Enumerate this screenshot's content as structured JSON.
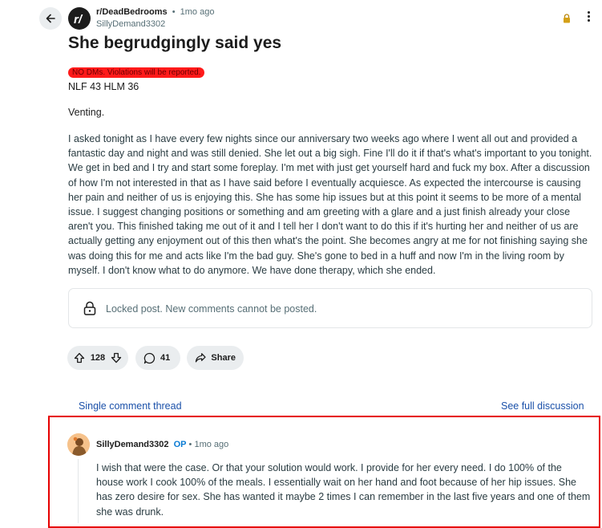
{
  "post": {
    "subreddit": "r/DeadBedrooms",
    "separator": "•",
    "time": "1mo ago",
    "author": "SillyDemand3302",
    "title": "She begrudgingly said yes",
    "flair": "NO DMs. Violations will be reported.",
    "tagline": "NLF 43 HLM 36",
    "venting": "Venting.",
    "body": "I asked tonight as I have every few nights since our anniversary two weeks ago where I went all out and provided a fantastic day and night and was still denied. She let out a big sigh. Fine I'll do it if that's what's important to you tonight. We get in bed and I try and start some foreplay. I'm met with just get yourself hard and fuck my box. After a discussion of how I'm not interested in that as I have said before I eventually acquiesce. As expected the intercourse is causing her pain and neither of us is enjoying this. She has some hip issues but at this point it seems to be more of a mental issue. I suggest changing positions or something and am greeting with a glare and a just finish already your close aren't you. This finished taking me out of it and I tell her I don't want to do this if it's hurting her and neither of us are actually getting any enjoyment out of this then what's the point. She becomes angry at me for not finishing saying she was doing this for me and acts like I'm the bad guy. She's gone to bed in a huff and now I'm in the living room by myself. I don't know what to do anymore. We have done therapy, which she ended.",
    "locked_notice": "Locked post. New comments cannot be posted.",
    "votes": "128",
    "comments": "41",
    "share_label": "Share"
  },
  "thread_nav": {
    "single_thread": "Single comment thread",
    "full_discussion": "See full discussion"
  },
  "comment": {
    "author": "SillyDemand3302",
    "op_badge": "OP",
    "separator": "•",
    "time": "1mo ago",
    "body": "I wish that were the case. Or that your solution would work. I provide for her every need. I do 100% of the house work I cook 100% of the meals. I essentially wait on her hand and foot because of her hip issues. She has zero desire for sex. She has wanted it maybe 2 times I can remember in the last five years and one of them she was drunk."
  },
  "icons": {
    "back": "arrow-left-icon",
    "subreddit_avatar": "subreddit-avatar",
    "lock": "lock-icon",
    "more": "more-options-icon",
    "upvote": "upvote-icon",
    "downvote": "downvote-icon",
    "comment": "comment-bubble-icon",
    "share": "share-icon"
  },
  "colors": {
    "flair_bg": "#ff1a1a",
    "link": "#1a50a9",
    "op_badge": "#0a7bd3",
    "highlight_border": "#e60000",
    "lock_gold": "#d4a017"
  }
}
